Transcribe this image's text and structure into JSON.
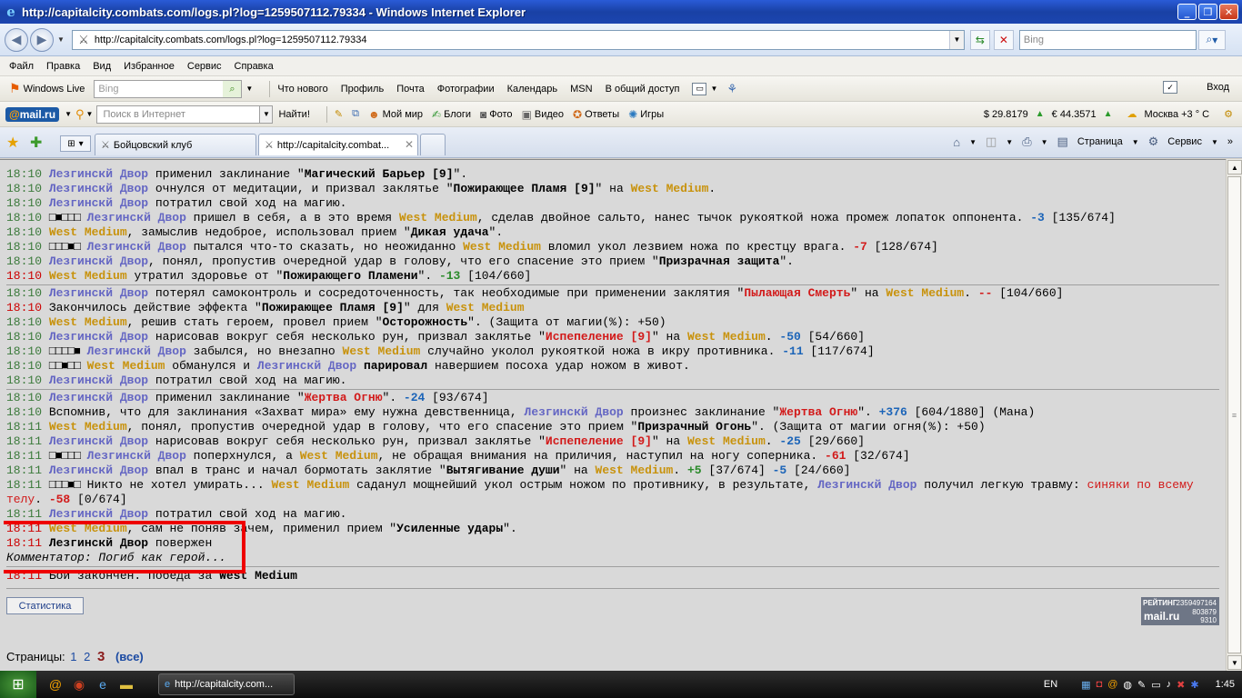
{
  "window": {
    "title": "http://capitalcity.combats.com/logs.pl?log=1259507112.79334 - Windows Internet Explorer"
  },
  "address": {
    "url": "http://capitalcity.combats.com/logs.pl?log=1259507112.79334",
    "search_placeholder": "Bing"
  },
  "menu": [
    "Файл",
    "Правка",
    "Вид",
    "Избранное",
    "Сервис",
    "Справка"
  ],
  "toolbar1": {
    "brand": "Windows Live",
    "search_placeholder": "Bing",
    "links": [
      "Что нового",
      "Профиль",
      "Почта",
      "Фотографии",
      "Календарь",
      "MSN",
      "В общий доступ"
    ],
    "login": "Вход"
  },
  "toolbar2": {
    "brand_prefix": "@",
    "brand": "mail.ru",
    "search_placeholder": "Поиск в Интернет",
    "find": "Найти!",
    "items": [
      "Мой мир",
      "Блоги",
      "Фото",
      "Видео",
      "Ответы",
      "Игры"
    ],
    "usd": "$ 29.8179",
    "eur": "€ 44.3571",
    "weather": "Москва +3 ° C"
  },
  "tabs": {
    "tab1": "Бойцовский клуб",
    "tab2": "http://capitalcity.combat...",
    "page": "Страница",
    "service": "Сервис"
  },
  "log": {
    "l1": {
      "t": "18:10",
      "a": "Лезгинскй Двор",
      "s1": " применил заклинание \"",
      "spell": "Магический Барьер [9]",
      "s2": "\"."
    },
    "l2": {
      "t": "18:10",
      "a": "Лезгинскй Двор",
      "s1": " очнулся от медитации, и призвал заклятье \"",
      "spell": "Пожирающее Пламя [9]",
      "s2": "\" на ",
      "b": "West Medium",
      "s3": "."
    },
    "l3": {
      "t": "18:10",
      "a": "Лезгинскй Двор",
      "s1": " потратил свой ход на магию."
    },
    "l4": {
      "t": "18:10",
      "bx": "□■□□□",
      "a": "Лезгинскй Двор",
      "s1": " пришел в себя, а в это время ",
      "b": "West Medium",
      "s2": ", сделав двойное сальто, нанес тычок рукояткой ножа промеж лопаток оппонента. ",
      "d": "-3",
      "s3": " [135/674]"
    },
    "l5": {
      "t": "18:10",
      "b": "West Medium",
      "s1": ", замыслив недоброе, использовал прием \"",
      "spell": "Дикая удача",
      "s2": "\"."
    },
    "l6": {
      "t": "18:10",
      "bx": "□□□■□",
      "a": "Лезгинскй Двор",
      "s1": " пытался что-то сказать, но неожиданно ",
      "b": "West Medium",
      "s2": " вломил укол лезвием ножа по крестцу врага. ",
      "d": "-7",
      "s3": " [128/674]"
    },
    "l7": {
      "t": "18:10",
      "a": "Лезгинскй Двор",
      "s1": ", понял, пропустив очередной удар в голову, что его спасение это прием \"",
      "spell": "Призрачная защита",
      "s2": "\"."
    },
    "l8": {
      "t": "18:10",
      "b": "West Medium",
      "s1": " утратил здоровье от \"",
      "spell": "Пожирающего Пламени",
      "s2": "\". ",
      "d": "-13",
      "s3": " [104/660]"
    },
    "l9": {
      "t": "18:10",
      "a": "Лезгинскй Двор",
      "s1": " потерял самоконтроль и сосредоточенность, так необходимые при применении заклятия \"",
      "spell": "Пылающая Смерть",
      "s2": "\" на ",
      "b": "West Medium",
      "s3": ". ",
      "d": "--",
      "s4": " [104/660]"
    },
    "l10": {
      "t": "18:10",
      "s1": " Закончилось действие эффекта \"",
      "spell": "Пожирающее Пламя [9]",
      "s2": "\" для ",
      "b": "West Medium"
    },
    "l11": {
      "t": "18:10",
      "b": "West Medium",
      "s1": ", решив стать героем, провел прием \"",
      "spell": "Осторожность",
      "s2": "\". (Защита от магии(%): +50)"
    },
    "l12": {
      "t": "18:10",
      "a": "Лезгинскй Двор",
      "s1": " нарисовав вокруг себя несколько рун, призвал заклятье \"",
      "spell": "Испепеление [9]",
      "s2": "\" на ",
      "b": "West Medium",
      "s3": ". ",
      "d": "-50",
      "s4": " [54/660]"
    },
    "l13": {
      "t": "18:10",
      "bx": "□□□□■",
      "a": "Лезгинскй Двор",
      "s1": " забылся, но внезапно ",
      "b": "West Medium",
      "s2": " случайно уколол рукояткой ножа в икру противника. ",
      "d": "-11",
      "s3": " [117/674]"
    },
    "l14": {
      "t": "18:10",
      "bx": "□□■□□",
      "b": "West Medium",
      "s1": " обманулся и ",
      "a": "Лезгинскй Двор",
      "s2": " ",
      "w": "парировал",
      "s3": " навершием посоха удар ножом в живот."
    },
    "l15": {
      "t": "18:10",
      "a": "Лезгинскй Двор",
      "s1": " потратил свой ход на магию."
    },
    "l16": {
      "t": "18:10",
      "a": "Лезгинскй Двор",
      "s1": " применил заклинание \"",
      "spell": "Жертва Огню",
      "s2": "\". ",
      "d": "-24",
      "s3": " [93/674]"
    },
    "l17": {
      "t": "18:10",
      "s1": " Вспомнив, что для заклинания «Захват мира» ему нужна девственница, ",
      "a": "Лезгинскй Двор",
      "s2": " произнес заклинание \"",
      "spell": "Жертва Огню",
      "s3": "\". ",
      "d": "+376",
      "s4": " [604/1880] (Мана)"
    },
    "l18": {
      "t": "18:11",
      "b": "West Medium",
      "s1": ", понял, пропустив очередной удар в голову, что его спасение это прием \"",
      "spell": "Призрачный Огонь",
      "s2": "\". (Защита от магии огня(%): +50)"
    },
    "l19": {
      "t": "18:11",
      "a": "Лезгинскй Двор",
      "s1": " нарисовав вокруг себя несколько рун, призвал заклятье \"",
      "spell": "Испепеление [9]",
      "s2": "\" на ",
      "b": "West Medium",
      "s3": ". ",
      "d": "-25",
      "s4": " [29/660]"
    },
    "l20": {
      "t": "18:11",
      "bx": "□■□□□",
      "a": "Лезгинскй Двор",
      "s1": " поперхнулся, а ",
      "b": "West Medium",
      "s2": ", не обращая внимания на приличия, наступил на ногу соперника. ",
      "d": "-61",
      "s3": " [32/674]"
    },
    "l21": {
      "t": "18:11",
      "a": "Лезгинскй Двор",
      "s1": " впал в транс и начал бормотать заклятие \"",
      "spell": "Вытягивание души",
      "s2": "\" на ",
      "b": "West Medium",
      "s3": ". ",
      "d1": "+5",
      "s4": " [37/674] ",
      "d2": "-5",
      "s5": " [24/660]"
    },
    "l22": {
      "t": "18:11",
      "bx": "□□□■□",
      "s1": " Никто не хотел умирать... ",
      "b": "West Medium",
      "s2": " саданул мощнейший укол острым ножом по противнику, в результате, ",
      "a": "Лезгинскй Двор",
      "s3": " получил легкую травму: ",
      "inj": "синяки по всему телу",
      "s4": ". ",
      "d": "-58",
      "s5": " [0/674]"
    },
    "l23": {
      "t": "18:11",
      "a": "Лезгинскй Двор",
      "s1": " потратил свой ход на магию."
    },
    "l24": {
      "t": "18:11",
      "b": "West Medium",
      "s1": ", сам не поняв зачем, применил прием \"",
      "spell": "Усиленные удары",
      "s2": "\"."
    },
    "l25": {
      "t": "18:11",
      "k": "Лезгинскй Двор",
      "s1": " повержен"
    },
    "comment": "Комментатор: Погиб как герой...",
    "end": {
      "t": "18:11",
      "s1": " Бой закончен. Победа за ",
      "w": "West Medium"
    }
  },
  "footer": {
    "stats": "Статистика",
    "pages_label": "Страницы:",
    "p1": "1",
    "p2": "2",
    "p3": "3",
    "all": "(все)"
  },
  "rating": {
    "label": "РЕЙТИНГ",
    "n1": "2359497164",
    "n2": "803879",
    "n3": "9310",
    "brand": "mail.ru"
  },
  "taskbar": {
    "task": "http://capitalcity.com...",
    "lang": "EN",
    "clock": "1:45"
  }
}
